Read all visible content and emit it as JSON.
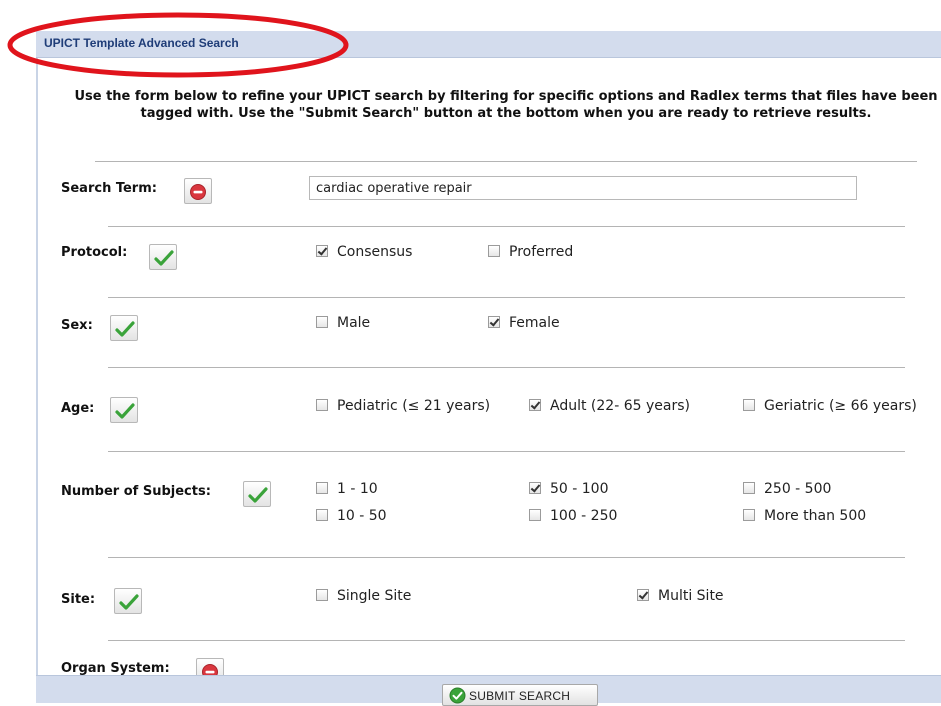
{
  "window": {
    "title": "UPICT Template Advanced Search"
  },
  "intro_text": "Use the form below to refine your UPICT search by filtering for specific options and Radlex terms that files have been tagged with. Use the \"Submit Search\" button at the bottom when you are ready to retrieve results.",
  "search_term": {
    "label": "Search Term:",
    "value": "cardiac operative repair",
    "button_icon": "remove-icon"
  },
  "protocol": {
    "label": "Protocol:",
    "button_icon": "checkmark-icon",
    "options": [
      {
        "label": "Consensus",
        "checked": true
      },
      {
        "label": "Proferred",
        "checked": false
      }
    ]
  },
  "sex": {
    "label": "Sex:",
    "button_icon": "checkmark-icon",
    "options": [
      {
        "label": "Male",
        "checked": false
      },
      {
        "label": "Female",
        "checked": true
      }
    ]
  },
  "age": {
    "label": "Age:",
    "button_icon": "checkmark-icon",
    "options": [
      {
        "label": "Pediatric (≤ 21 years)",
        "checked": false
      },
      {
        "label": "Adult (22- 65 years)",
        "checked": true
      },
      {
        "label": "Geriatric (≥ 66 years)",
        "checked": false
      }
    ]
  },
  "subjects": {
    "label": "Number of Subjects:",
    "button_icon": "checkmark-icon",
    "options": [
      {
        "label": "1 - 10",
        "checked": false
      },
      {
        "label": "50 - 100",
        "checked": true
      },
      {
        "label": "250 - 500",
        "checked": false
      },
      {
        "label": "10 - 50",
        "checked": false
      },
      {
        "label": "100 - 250",
        "checked": false
      },
      {
        "label": "More than 500",
        "checked": false
      }
    ]
  },
  "site": {
    "label": "Site:",
    "button_icon": "checkmark-icon",
    "options": [
      {
        "label": "Single Site",
        "checked": false
      },
      {
        "label": "Multi Site",
        "checked": true
      }
    ]
  },
  "organ_system": {
    "label": "Organ System:",
    "button_icon": "remove-icon"
  },
  "footer": {
    "submit_label": "SUBMIT SEARCH",
    "submit_icon": "ok-circle-icon"
  },
  "colors": {
    "title_bar": "#d3dced",
    "title_text": "#1f3d78",
    "annotation": "#e0141c",
    "check_green": "#3aa33a",
    "remove_red": "#d9363e"
  }
}
